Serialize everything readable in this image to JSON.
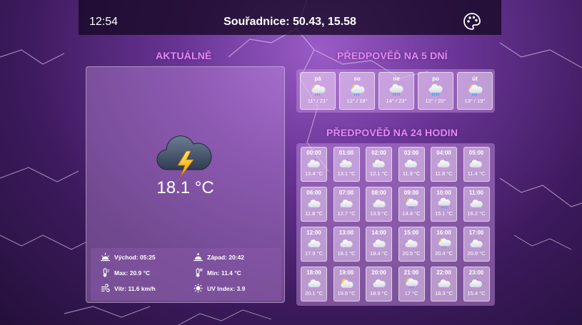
{
  "header": {
    "time": "12:54",
    "coordinates": "Souřadnice: 50.43, 15.58",
    "theme_icon": "palette-icon"
  },
  "current": {
    "title": "AKTUÁLNĚ",
    "icon": "thunderstorm-icon",
    "temperature": "18.1 °C",
    "details": {
      "sunrise": "Východ: 05:25",
      "sunset": "Západ: 20:42",
      "max": "Max: 20.9 °C",
      "min": "Min: 11.4 °C",
      "wind": "Vítr:  11.6 km/h",
      "uv": "UV Index: 3.9"
    }
  },
  "forecast5": {
    "title": "PŘEDPOVĚĎ NA 5 DNÍ",
    "days": [
      {
        "name": "pá",
        "range": "11° / 21°",
        "icon": "sun-cloud-rain-icon"
      },
      {
        "name": "so",
        "range": "12° / 19°",
        "icon": "sun-cloud-rain-icon"
      },
      {
        "name": "ne",
        "range": "14° / 23°",
        "icon": "cloud-rain-icon"
      },
      {
        "name": "po",
        "range": "12° / 20°",
        "icon": "cloud-rain-icon"
      },
      {
        "name": "út",
        "range": "13° / 19°",
        "icon": "sun-cloud-rain-icon"
      }
    ]
  },
  "forecast24": {
    "title": "PŘEDPOVĚĎ NA 24 HODIN",
    "hours": [
      {
        "time": "00:00",
        "temp": "13.4 °C",
        "icon": "moon-cloud-icon"
      },
      {
        "time": "01:00",
        "temp": "13.1 °C",
        "icon": "moon-cloud-icon"
      },
      {
        "time": "02:00",
        "temp": "12.1 °C",
        "icon": "moon-cloud-icon"
      },
      {
        "time": "03:00",
        "temp": "11.9 °C",
        "icon": "moon-cloud-icon"
      },
      {
        "time": "04:00",
        "temp": "11.8 °C",
        "icon": "moon-cloud-icon"
      },
      {
        "time": "05:00",
        "temp": "11.4 °C",
        "icon": "moon-cloud-icon"
      },
      {
        "time": "06:00",
        "temp": "11.8 °C",
        "icon": "cloud-icon"
      },
      {
        "time": "07:00",
        "temp": "12.7 °C",
        "icon": "cloud-icon"
      },
      {
        "time": "08:00",
        "temp": "13.9 °C",
        "icon": "cloud-icon"
      },
      {
        "time": "09:00",
        "temp": "14.4 °C",
        "icon": "sun-cloud-rain-icon"
      },
      {
        "time": "10:00",
        "temp": "15.1 °C",
        "icon": "cloud-rain-icon"
      },
      {
        "time": "11:00",
        "temp": "16.2 °C",
        "icon": "cloud-icon"
      },
      {
        "time": "12:00",
        "temp": "17.9 °C",
        "icon": "cloud-icon"
      },
      {
        "time": "13:00",
        "temp": "18.1 °C",
        "icon": "cloud-icon"
      },
      {
        "time": "14:00",
        "temp": "19.4 °C",
        "icon": "cloud-icon"
      },
      {
        "time": "15:00",
        "temp": "20.5 °C",
        "icon": "cloud-icon"
      },
      {
        "time": "16:00",
        "temp": "20.4 °C",
        "icon": "sun-cloud-rain-icon"
      },
      {
        "time": "17:00",
        "temp": "20.9 °C",
        "icon": "cloud-icon"
      },
      {
        "time": "18:00",
        "temp": "20.1 °C",
        "icon": "cloud-icon"
      },
      {
        "time": "19:00",
        "temp": "19.8 °C",
        "icon": "sun-cloud-icon"
      },
      {
        "time": "20:00",
        "temp": "18.9 °C",
        "icon": "cloud-icon"
      },
      {
        "time": "21:00",
        "temp": "17 °C",
        "icon": "sun-cloud-rain-icon"
      },
      {
        "time": "22:00",
        "temp": "18.3 °C",
        "icon": "cloud-icon"
      },
      {
        "time": "23:00",
        "temp": "15.4 °C",
        "icon": "moon-cloud-icon"
      }
    ]
  },
  "colors": {
    "section_title": "#e08cf0",
    "topbar": "#150826",
    "card": "#c89ee0"
  }
}
